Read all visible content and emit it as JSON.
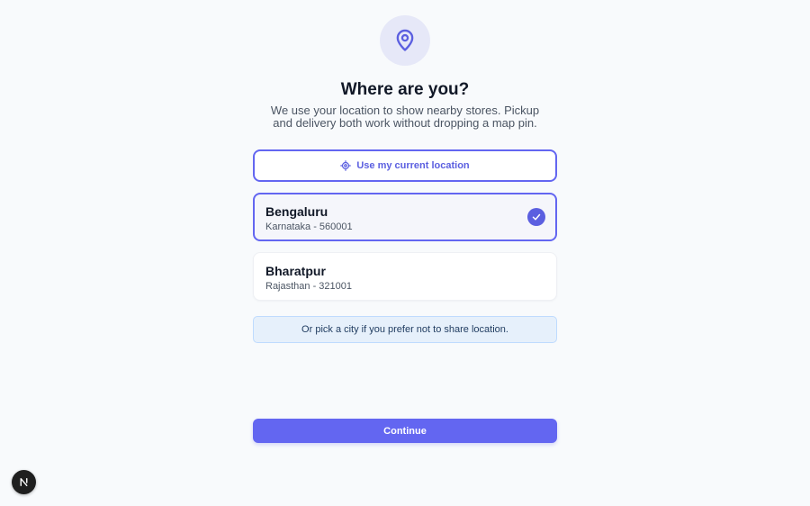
{
  "header": {
    "icon": "map-pin-icon",
    "title": "Where are you?",
    "subtitle": "We use your location to show nearby stores. Pickup and delivery both work without dropping a map pin."
  },
  "locate_button": {
    "icon": "crosshair-icon",
    "label": "Use my current location"
  },
  "cities": [
    {
      "name": "Bengaluru",
      "sub": "Karnataka - 560001",
      "selected": true
    },
    {
      "name": "Bharatpur",
      "sub": "Rajasthan - 321001",
      "selected": false
    }
  ],
  "hint": "Or pick a city if you prefer not to share location.",
  "continue_label": "Continue",
  "dev_badge": {
    "icon": "nextjs-logo-icon",
    "letter": "N"
  },
  "colors": {
    "accent": "#6366f1",
    "background": "#f8fafc",
    "hint_background": "#e6f0fb"
  }
}
